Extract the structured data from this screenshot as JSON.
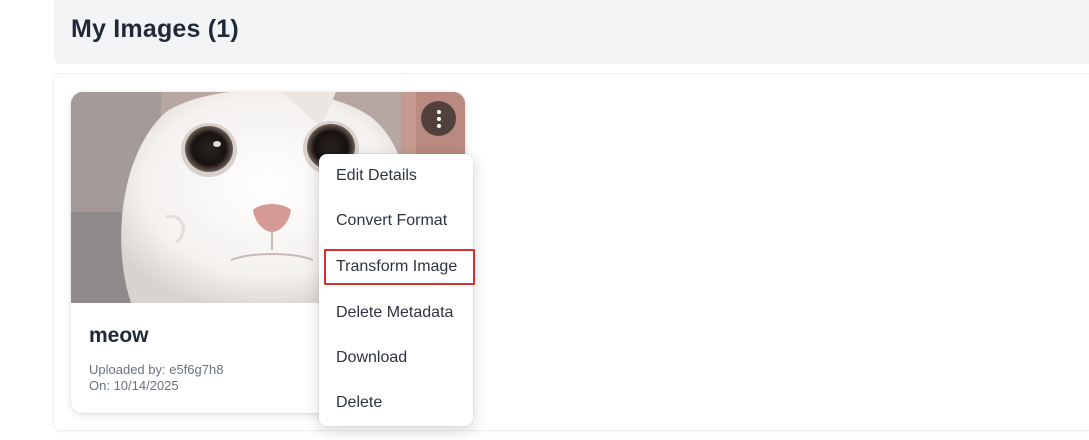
{
  "page": {
    "title": "My Images (1)"
  },
  "images": [
    {
      "name": "meow",
      "uploaded_by": "Uploaded by: e5f6g7h8",
      "uploaded_on": "On: 10/14/2025",
      "thumbnail_icon": "white-cat-photo"
    }
  ],
  "menu": {
    "trigger_icon": "kebab-vertical-icon",
    "items": [
      {
        "label": "Edit Details"
      },
      {
        "label": "Convert Format"
      },
      {
        "label": "Transform Image",
        "highlighted": true
      },
      {
        "label": "Delete Metadata"
      },
      {
        "label": "Download"
      },
      {
        "label": "Delete"
      }
    ]
  },
  "colors": {
    "highlight_border": "#d32f2f",
    "header_bg": "#f3f4f6",
    "title_text": "#1f2937",
    "muted_text": "#6b7280"
  }
}
